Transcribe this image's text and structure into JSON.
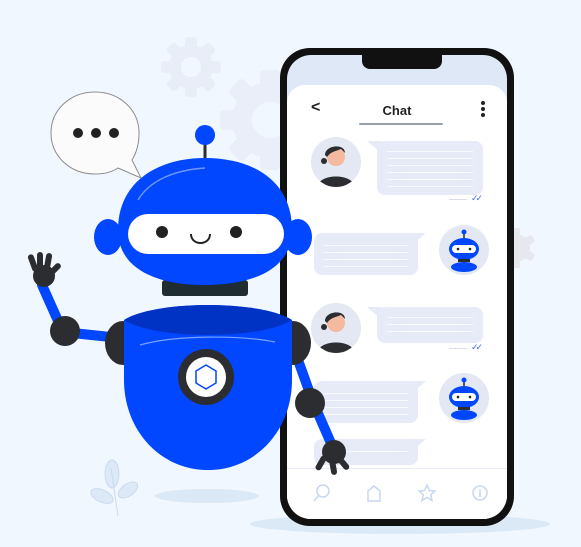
{
  "chat": {
    "title": "Chat",
    "back_icon": "chevron-left-icon",
    "menu_icon": "more-vertical-icon"
  },
  "messages": [
    {
      "sender": "user",
      "avatar": "woman-avatar",
      "lines": 6,
      "read_receipt": "double-check-icon"
    },
    {
      "sender": "bot",
      "avatar": "robot-avatar",
      "lines": 4
    },
    {
      "sender": "user",
      "avatar": "woman-avatar",
      "lines": 3,
      "read_receipt": "double-check-icon"
    },
    {
      "sender": "bot",
      "avatar": "robot-avatar",
      "lines": 4
    },
    {
      "sender": "bot",
      "lines": 1
    }
  ],
  "tabbar": [
    {
      "name": "search",
      "icon": "search-icon"
    },
    {
      "name": "home",
      "icon": "home-icon"
    },
    {
      "name": "favorites",
      "icon": "star-icon"
    },
    {
      "name": "info",
      "icon": "info-icon"
    }
  ],
  "speech_bubble": {
    "icon": "typing-dots-icon",
    "text": "•••"
  },
  "colors": {
    "background": "#f1f7ff",
    "robot_blue": "#0047ff",
    "robot_dark": "#2b2d31",
    "bubble": "#e6ebf7",
    "check_blue": "#3a6df0"
  }
}
